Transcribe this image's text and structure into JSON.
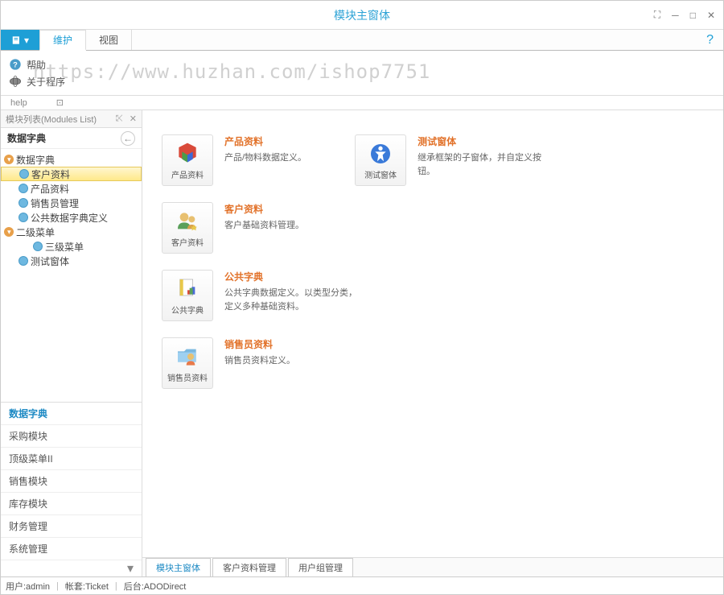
{
  "window": {
    "title": "模块主窗体"
  },
  "ribbon": {
    "tabs": {
      "maintain": "维护",
      "view": "视图"
    },
    "items": {
      "help": "帮助",
      "about": "关于程序"
    },
    "group_label": "help"
  },
  "watermark": "https://www.huzhan.com/ishop7751",
  "sidebar": {
    "panel_title": "模块列表(Modules List)",
    "section_title": "数据字典",
    "tree": {
      "root1": "数据字典",
      "n1": "客户资料",
      "n2": "产品资料",
      "n3": "销售员管理",
      "n4": "公共数据字典定义",
      "root2": "二级菜单",
      "n5": "三级菜单",
      "n6": "测试窗体"
    },
    "accordion": {
      "a1": "数据字典",
      "a2": "采购模块",
      "a3": "顶级菜单II",
      "a4": "销售模块",
      "a5": "库存模块",
      "a6": "财务管理",
      "a7": "系统管理"
    }
  },
  "modules": {
    "product": {
      "caption": "产品资料",
      "title": "产品资料",
      "desc": "产品/物料数据定义。"
    },
    "test": {
      "caption": "测试窗体",
      "title": "测试窗体",
      "desc": "继承框架的子窗体，并自定义按钮。"
    },
    "customer": {
      "caption": "客户资料",
      "title": "客户资料",
      "desc": "客户基础资料管理。"
    },
    "dict": {
      "caption": "公共字典",
      "title": "公共字典",
      "desc": "公共字典数据定义。以类型分类，定义多种基础资料。"
    },
    "sales": {
      "caption": "销售员资料",
      "title": "销售员资料",
      "desc": "销售员资料定义。"
    }
  },
  "bottom_tabs": {
    "t1": "模块主窗体",
    "t2": "客户资料管理",
    "t3": "用户组管理"
  },
  "statusbar": {
    "user": "用户:admin",
    "account": "帐套:Ticket",
    "backend": "后台:ADODirect"
  }
}
